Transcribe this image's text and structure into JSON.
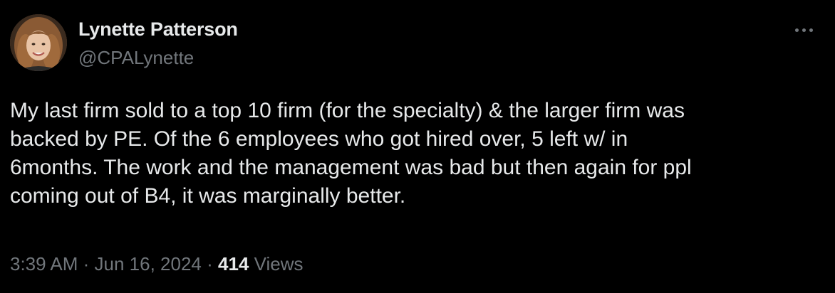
{
  "author": {
    "display_name": "Lynette Patterson",
    "handle": "@CPALynette"
  },
  "more_icon": "more-horizontal-icon",
  "tweet": {
    "text_lines": [
      "My last firm sold to a top 10 firm (for the specialty) & the larger firm was",
      "backed by PE. Of the 6 employees who got hired over, 5 left w/ in",
      "6months. The work and the management was bad but then again for ppl",
      "coming out of B4, it was marginally better."
    ]
  },
  "meta": {
    "time": "3:39 AM",
    "separator": " · ",
    "date": "Jun 16, 2024",
    "views_count": "414",
    "views_label": " Views"
  },
  "colors": {
    "background": "#000000",
    "primary_text": "#e7e9ea",
    "secondary_text": "#71767b"
  }
}
